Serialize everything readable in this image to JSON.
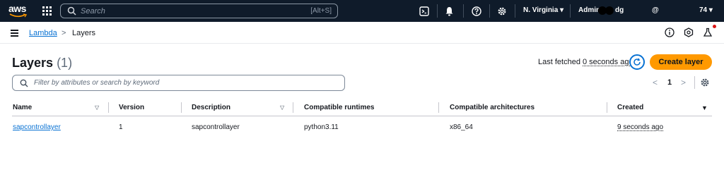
{
  "topbar": {
    "logo_text": "aws",
    "search_placeholder": "Search",
    "search_shortcut": "[Alt+S]",
    "region": "N. Virginia ▾",
    "account_prefix": "Admin",
    "account_mid": "dg",
    "account_at": "@",
    "account_suffix": "74 ▾"
  },
  "breadcrumb": {
    "service": "Lambda",
    "separator": ">",
    "current": "Layers"
  },
  "header": {
    "title": "Layers",
    "count": "(1)",
    "last_fetched_label": "Last fetched",
    "last_fetched_value": "0 seconds ago",
    "create_button": "Create layer"
  },
  "filter": {
    "placeholder": "Filter by attributes or search by keyword"
  },
  "pagination": {
    "prev": "<",
    "page": "1",
    "next": ">"
  },
  "table": {
    "columns": [
      "Name",
      "Version",
      "Description",
      "Compatible runtimes",
      "Compatible architectures",
      "Created"
    ],
    "rows": [
      {
        "name": "sapcontrollayer",
        "version": "1",
        "description": "sapcontrollayer",
        "runtimes": "python3.11",
        "architectures": "x86_64",
        "created": "9 seconds ago"
      }
    ]
  },
  "colors": {
    "topbar_bg": "#0f1b2a",
    "link": "#0972d3",
    "primary_button": "#ff9900"
  }
}
